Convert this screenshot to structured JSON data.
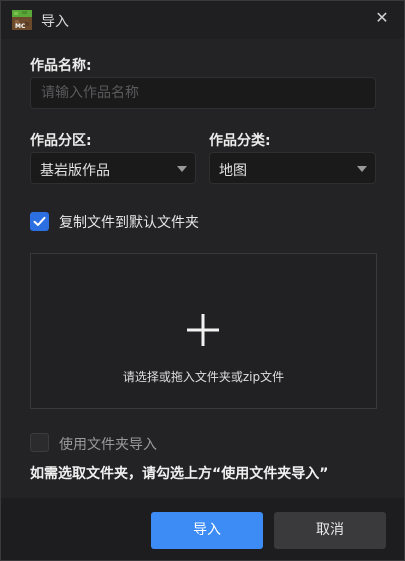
{
  "window": {
    "title": "导入"
  },
  "form": {
    "name_label": "作品名称:",
    "name_placeholder": "请输入作品名称",
    "zone_label": "作品分区:",
    "zone_value": "基岩版作品",
    "category_label": "作品分类:",
    "category_value": "地图",
    "copy_checkbox": {
      "label": "复制文件到默认文件夹",
      "checked": true
    },
    "dropzone_text": "请选择或拖入文件夹或zip文件",
    "folder_checkbox": {
      "label": "使用文件夹导入",
      "checked": false
    },
    "hint": "如需选取文件夹，请勾选上方“使用文件夹导入”"
  },
  "footer": {
    "import_label": "导入",
    "cancel_label": "取消"
  },
  "colors": {
    "accent": "#3d8cf5",
    "checkbox": "#2b6fe0",
    "background": "#232325"
  }
}
